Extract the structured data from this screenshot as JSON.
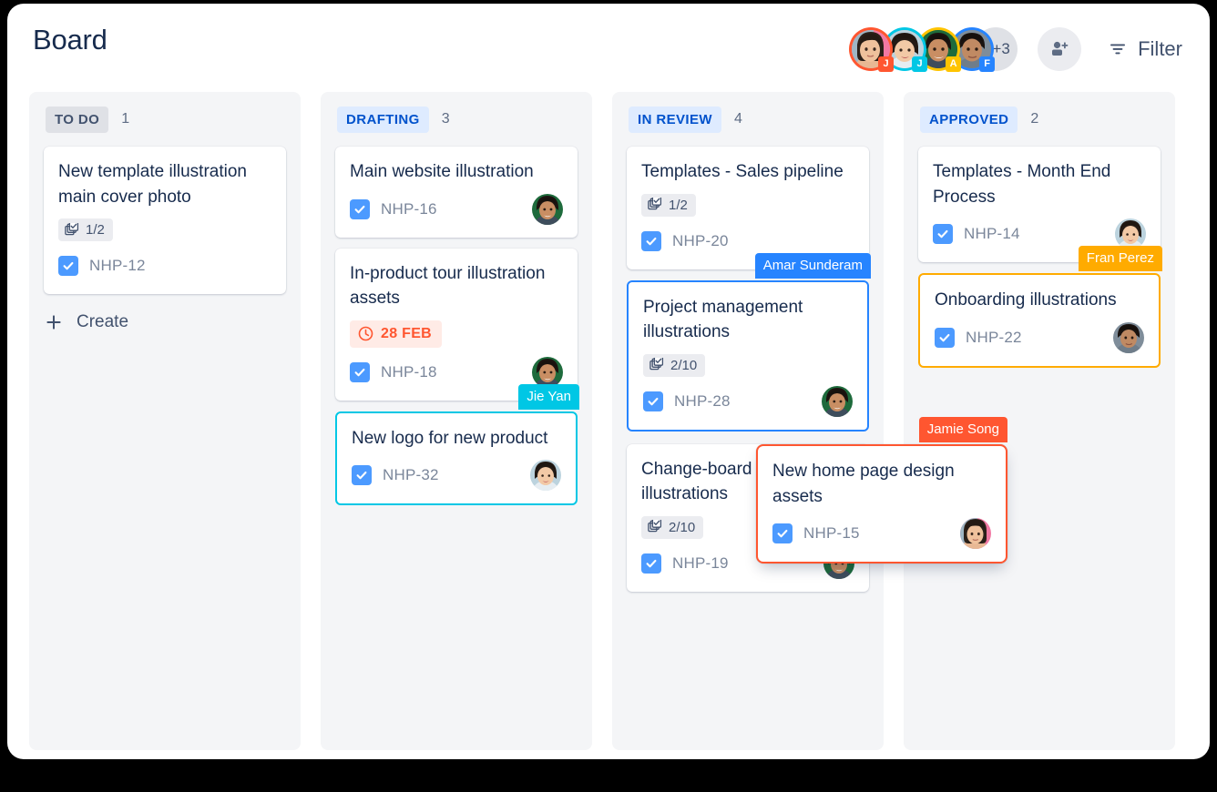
{
  "header": {
    "title": "Board",
    "filter_label": "Filter",
    "filter_icon": "filter-icon",
    "add_person_icon": "person-add-icon",
    "overflow_count": "+3",
    "avatars": [
      {
        "name": "avatar-1",
        "ring": "#FF5630",
        "badge": "J",
        "badge_color": "#FF5630"
      },
      {
        "name": "avatar-2",
        "ring": "#00C7E5",
        "badge": "J",
        "badge_color": "#00C7E5"
      },
      {
        "name": "avatar-3",
        "ring": "#FFC400",
        "badge": "A",
        "badge_color": "#FFC400"
      },
      {
        "name": "avatar-4",
        "ring": "#2684FF",
        "badge": "F",
        "badge_color": "#2684FF"
      }
    ]
  },
  "columns": [
    {
      "id": "todo",
      "name": "TO DO",
      "count": "1",
      "badge_bg": "#DFE1E6",
      "badge_fg": "#42526E",
      "create_label": "Create",
      "create_icon": "plus-icon",
      "cards": [
        {
          "title": "New template illustration main cover photo",
          "subtasks": "1/2",
          "key": "NHP-12",
          "has_avatar": false,
          "due": null,
          "flag": null
        }
      ]
    },
    {
      "id": "drafting",
      "name": "DRAFTING",
      "count": "3",
      "badge_bg": "#DEEBFF",
      "badge_fg": "#0052CC",
      "cards": [
        {
          "title": "Main website illustration",
          "subtasks": null,
          "key": "NHP-16",
          "has_avatar": true,
          "avatar": "avatar-amar",
          "due": null,
          "flag": null
        },
        {
          "title": "In-product tour illustration assets",
          "subtasks": null,
          "key": "NHP-18",
          "has_avatar": true,
          "avatar": "avatar-amar",
          "due": "28 FEB",
          "due_icon": "clock-icon",
          "flag": null
        },
        {
          "title": "New logo for new product",
          "subtasks": null,
          "key": "NHP-32",
          "has_avatar": true,
          "avatar": "avatar-jie",
          "due": null,
          "flag": {
            "label": "Jie Yan",
            "color": "#00C7E5",
            "style": "cyan"
          }
        }
      ]
    },
    {
      "id": "in-review",
      "name": "IN REVIEW",
      "count": "4",
      "badge_bg": "#DEEBFF",
      "badge_fg": "#0052CC",
      "cards": [
        {
          "title": "Templates - Sales pipeline",
          "subtasks": "1/2",
          "key": "NHP-20",
          "has_avatar": false,
          "due": null,
          "flag": null
        },
        {
          "title": "Project management illustrations",
          "subtasks": "2/10",
          "key": "NHP-28",
          "has_avatar": true,
          "avatar": "avatar-amar",
          "due": null,
          "flag": {
            "label": "Amar Sunderam",
            "color": "#2684FF",
            "style": "blue"
          }
        },
        {
          "title": "Change-board users illustrations",
          "subtasks": "2/10",
          "key": "NHP-19",
          "has_avatar": true,
          "avatar": "avatar-amar",
          "due": null,
          "flag": null
        }
      ]
    },
    {
      "id": "approved",
      "name": "APPROVED",
      "count": "2",
      "badge_bg": "#DEEBFF",
      "badge_fg": "#0052CC",
      "cards": [
        {
          "title": "Templates - Month End Process",
          "subtasks": null,
          "key": "NHP-14",
          "has_avatar": true,
          "avatar": "avatar-jie",
          "due": null,
          "flag": null
        },
        {
          "title": "Onboarding illustrations",
          "subtasks": null,
          "key": "NHP-22",
          "has_avatar": true,
          "avatar": "avatar-fran",
          "due": null,
          "flag": {
            "label": "Fran Perez",
            "color": "#FFAB00",
            "style": "yellow"
          }
        }
      ]
    }
  ],
  "dragging_card": {
    "title": "New home page design assets",
    "key": "NHP-15",
    "avatar": "avatar-jamie",
    "flag": {
      "label": "Jamie Song",
      "color": "#FF5630",
      "style": "orange"
    }
  },
  "colors": {
    "page_bg": "#FFFFFF",
    "column_bg": "#F4F5F7",
    "card_bg": "#FFFFFF",
    "text_primary": "#172B4D",
    "text_subtle": "#7A869A",
    "accent_blue": "#0052CC",
    "check_blue": "#4C9AFF",
    "due_red": "#FF5630",
    "due_bg": "#FFEBE6"
  }
}
